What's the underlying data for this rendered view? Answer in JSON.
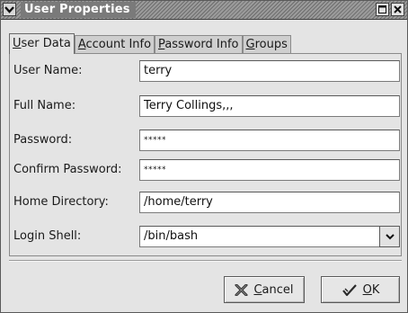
{
  "window": {
    "title": "User Properties"
  },
  "tabs": [
    {
      "label_mnemonic": "U",
      "label_rest": "ser Data",
      "active": true
    },
    {
      "label_mnemonic": "A",
      "label_rest": "ccount Info",
      "active": false
    },
    {
      "label_mnemonic": "P",
      "label_rest": "assword Info",
      "active": false
    },
    {
      "label_mnemonic": "G",
      "label_rest": "roups",
      "active": false
    }
  ],
  "form": {
    "user_name": {
      "label": "User Name:",
      "value": "terry"
    },
    "full_name": {
      "label": "Full Name:",
      "value": "Terry Collings,,,"
    },
    "password": {
      "label": "Password:",
      "value": "*****"
    },
    "confirm_password": {
      "label": "Confirm Password:",
      "value": "*****"
    },
    "home_directory": {
      "label": "Home Directory:",
      "value": "/home/terry"
    },
    "login_shell": {
      "label": "Login Shell:",
      "value": "/bin/bash"
    }
  },
  "buttons": {
    "cancel": {
      "mnemonic": "C",
      "rest": "ancel"
    },
    "ok": {
      "mnemonic": "O",
      "rest": "K"
    }
  },
  "icons": {
    "window_menu": "chevron-down-icon",
    "maximize": "maximize-icon",
    "close": "close-icon",
    "combo": "chevron-down-icon",
    "cancel": "cancel-x-icon",
    "ok": "checkmark-icon"
  }
}
